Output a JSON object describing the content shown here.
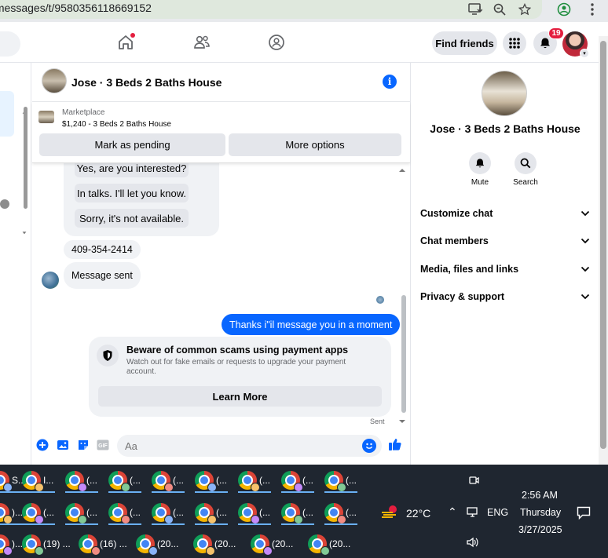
{
  "browser": {
    "url": "/messages/t/9580356118669152"
  },
  "header": {
    "find_friends": "Find friends",
    "notification_count": "19"
  },
  "chat": {
    "title": "Jose · 3 Beds 2 Baths House",
    "marketplace_label": "Marketplace",
    "listing": "$1,240 - 3 Beds 2 Baths House",
    "mark_pending": "Mark as pending",
    "more_options": "More options",
    "quick_replies": [
      "Yes, are you interested?",
      "In talks. I'll let you know.",
      "Sorry, it's not available."
    ],
    "messages": {
      "phone": "409-354-2414",
      "sent_notice": "Message sent",
      "outgoing": "Thanks i\"il message you in a moment"
    },
    "warning": {
      "title": "Beware of common scams using payment apps",
      "body": "Watch out for fake emails or requests to upgrade your payment account.",
      "button": "Learn More"
    },
    "sent_status": "Sent",
    "composer_placeholder": "Aa",
    "gif_label": "GIF"
  },
  "info_panel": {
    "title": "Jose · 3 Beds 2 Baths House",
    "mute": "Mute",
    "search": "Search",
    "sections": [
      "Customize chat",
      "Chat members",
      "Media, files and links",
      "Privacy & support"
    ]
  },
  "taskbar": {
    "row1": [
      "S...",
      "I...",
      "(...",
      "(...",
      "(...",
      "(...",
      "(...",
      "(...",
      "(..."
    ],
    "row2": [
      ")...",
      "(...",
      "(...",
      "(...",
      "(...",
      "(...",
      "(...",
      "(...",
      "(..."
    ],
    "row3": [
      ")...",
      "(19) ...",
      "(16) ...",
      "(20...",
      "(20...",
      "(20...",
      "(20..."
    ],
    "temperature": "22°C",
    "language": "ENG",
    "time": "2:56 AM",
    "day": "Thursday",
    "date": "3/27/2025"
  },
  "colors": {
    "accent": "#0866ff",
    "badge": "#e41e3f",
    "taskbar": "#1f2630"
  }
}
